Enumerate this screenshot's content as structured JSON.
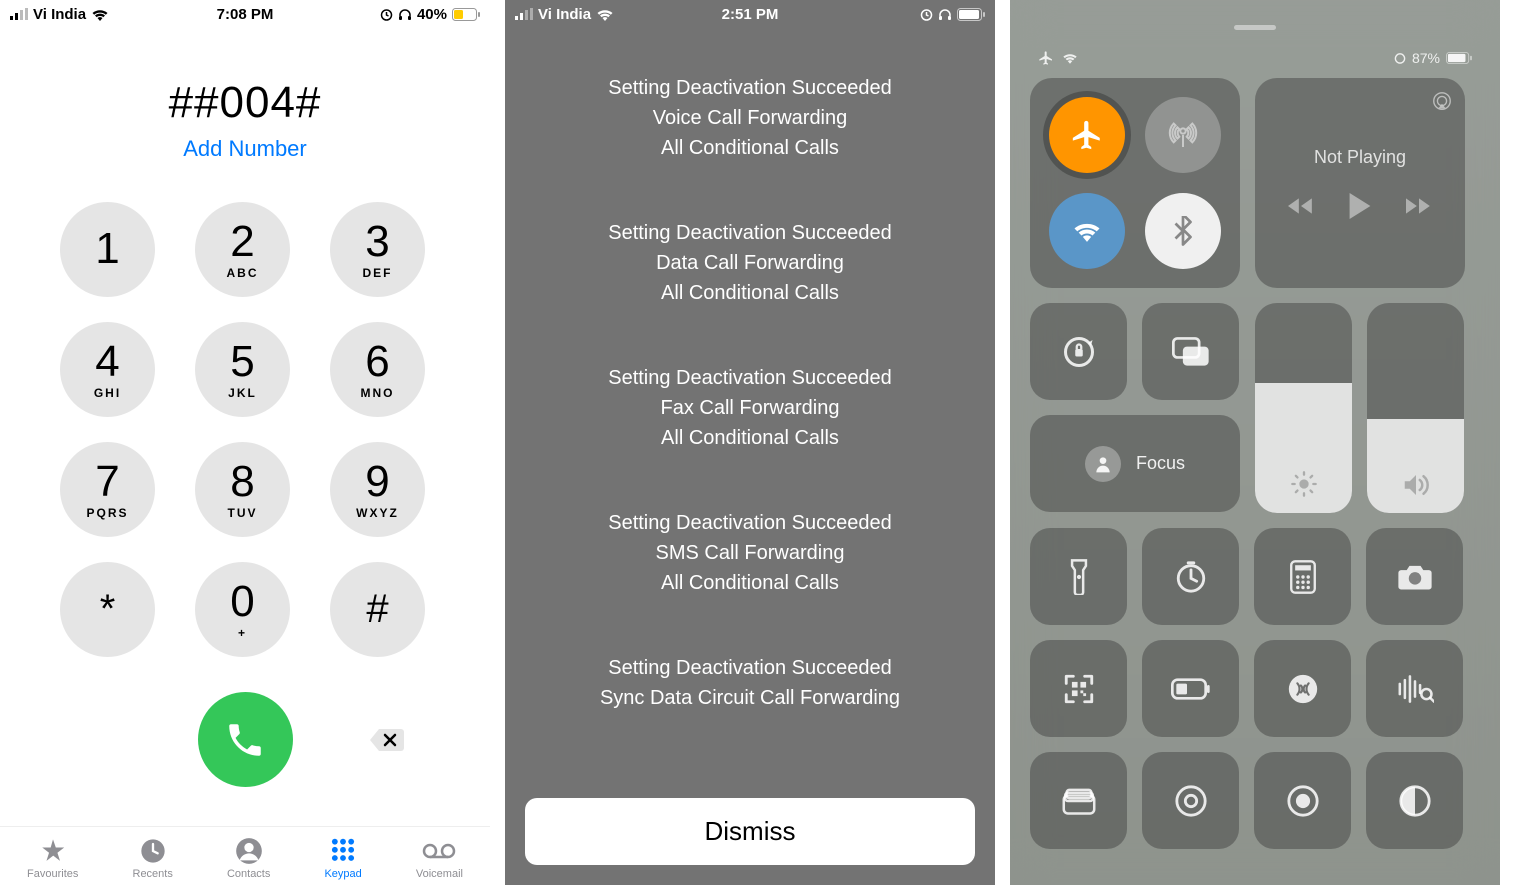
{
  "screen1": {
    "status": {
      "carrier": "Vi India",
      "time": "7:08 PM",
      "battery": "40%"
    },
    "dialedNumber": "##004#",
    "addNumber": "Add Number",
    "keys": [
      {
        "d": "1",
        "l": ""
      },
      {
        "d": "2",
        "l": "ABC"
      },
      {
        "d": "3",
        "l": "DEF"
      },
      {
        "d": "4",
        "l": "GHI"
      },
      {
        "d": "5",
        "l": "JKL"
      },
      {
        "d": "6",
        "l": "MNO"
      },
      {
        "d": "7",
        "l": "PQRS"
      },
      {
        "d": "8",
        "l": "TUV"
      },
      {
        "d": "9",
        "l": "WXYZ"
      },
      {
        "d": "*",
        "l": ""
      },
      {
        "d": "0",
        "l": "+"
      },
      {
        "d": "#",
        "l": ""
      }
    ],
    "tabs": [
      "Favourites",
      "Recents",
      "Contacts",
      "Keypad",
      "Voicemail"
    ]
  },
  "screen2": {
    "status": {
      "carrier": "Vi India",
      "time": "2:51 PM"
    },
    "blocks": [
      [
        "Setting Deactivation Succeeded",
        "Voice Call Forwarding",
        "All Conditional Calls"
      ],
      [
        "Setting Deactivation Succeeded",
        "Data Call Forwarding",
        "All Conditional Calls"
      ],
      [
        "Setting Deactivation Succeeded",
        "Fax Call Forwarding",
        "All Conditional Calls"
      ],
      [
        "Setting Deactivation Succeeded",
        "SMS Call Forwarding",
        "All Conditional Calls"
      ],
      [
        "Setting Deactivation Succeeded",
        "Sync Data Circuit Call Forwarding"
      ]
    ],
    "dismiss": "Dismiss"
  },
  "screen3": {
    "battery": "87%",
    "nowPlaying": "Not Playing",
    "focus": "Focus",
    "brightnessFill": 62,
    "volumeFill": 45
  }
}
